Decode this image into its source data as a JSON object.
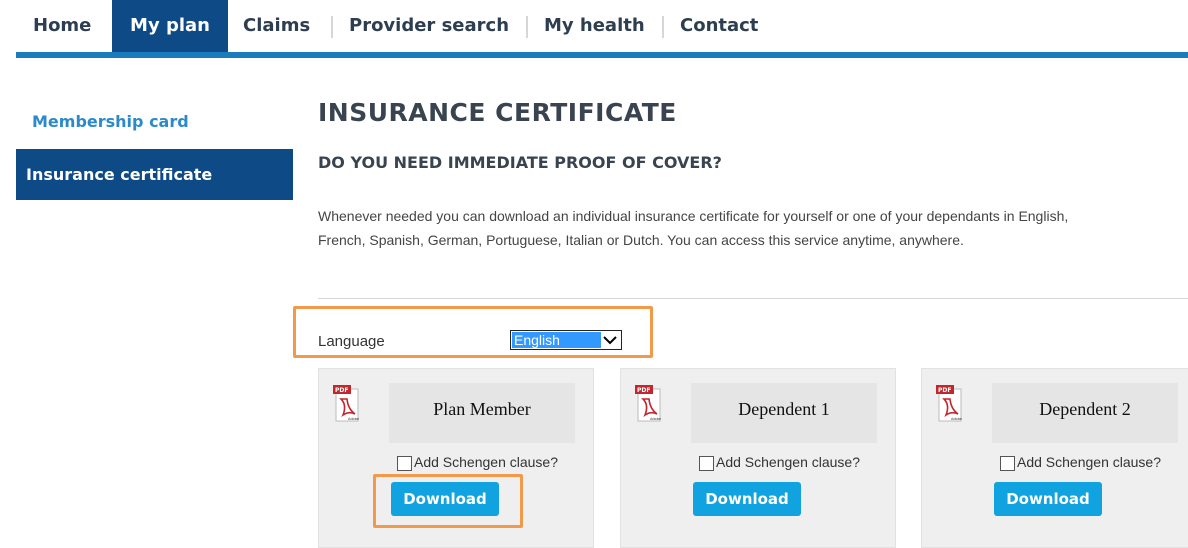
{
  "nav": {
    "items": [
      {
        "label": "Home"
      },
      {
        "label": "My plan"
      },
      {
        "label": "Claims"
      },
      {
        "label": "Provider search"
      },
      {
        "label": "My health"
      },
      {
        "label": "Contact"
      }
    ],
    "active_index": 1,
    "accent_color": "#1a7bbd",
    "active_color": "#0d4a86"
  },
  "sidebar": {
    "items": [
      {
        "label": "Membership card"
      },
      {
        "label": "Insurance certificate"
      }
    ]
  },
  "main": {
    "title": "INSURANCE CERTIFICATE",
    "subtitle": "DO YOU NEED IMMEDIATE PROOF OF COVER?",
    "paragraph_line1": "Whenever needed you can download an individual insurance certificate for yourself or one of your dependants in English,",
    "paragraph_line2": "French, Spanish, German, Portuguese, Italian or Dutch. You can access this service anytime, anywhere.",
    "language_label": "Language",
    "language_selected": "English",
    "cards": [
      {
        "name": "Plan Member",
        "checkbox_label": "Add Schengen clause?",
        "button_label": "Download",
        "icon": "pdf-icon"
      },
      {
        "name": "Dependent 1",
        "checkbox_label": "Add Schengen clause?",
        "button_label": "Download",
        "icon": "pdf-icon"
      },
      {
        "name": "Dependent 2",
        "checkbox_label": "Add Schengen clause?",
        "button_label": "Download",
        "icon": "pdf-icon"
      }
    ]
  },
  "highlight_color": "#f39a4a",
  "button_color": "#11a3e0"
}
